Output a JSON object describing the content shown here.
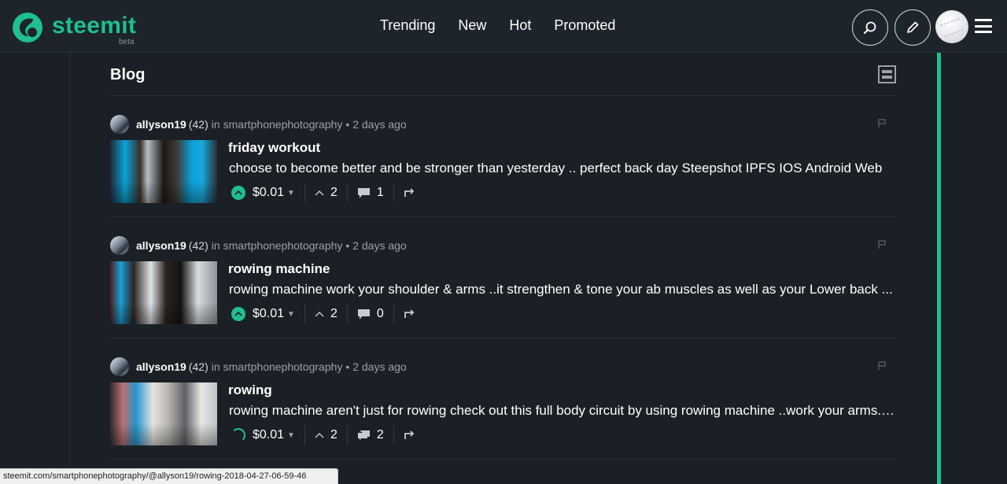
{
  "app": {
    "brand": "steemit",
    "beta": "beta",
    "brand_color": "#1fbf8f"
  },
  "nav": {
    "items": [
      {
        "label": "Trending"
      },
      {
        "label": "New"
      },
      {
        "label": "Hot"
      },
      {
        "label": "Promoted"
      }
    ]
  },
  "header": {
    "search_icon": "search-icon",
    "edit_icon": "pencil-icon",
    "menu_icon": "hamburger-icon"
  },
  "blog": {
    "title": "Blog"
  },
  "posts": [
    {
      "author": "allyson19",
      "reputation": "(42)",
      "in_label": "in",
      "community": "smartphonephotography",
      "time": "• 2 days ago",
      "title": "friday workout",
      "excerpt": "choose to become better and be stronger than yesterday .. perfect back day Steepshot IPFS IOS Android Web",
      "payout": "$0.01",
      "votes": "2",
      "comments": "1"
    },
    {
      "author": "allyson19",
      "reputation": "(42)",
      "in_label": "in",
      "community": "smartphonephotography",
      "time": "• 2 days ago",
      "title": "rowing machine",
      "excerpt": "rowing machine work your shoulder & arms ..it strengthen & tone your ab muscles as well as your Lower back ...",
      "payout": "$0.01",
      "votes": "2",
      "comments": "0"
    },
    {
      "author": "allyson19",
      "reputation": "(42)",
      "in_label": "in",
      "community": "smartphonephotography",
      "time": "• 2 days ago",
      "title": "rowing",
      "excerpt": "rowing machine aren't just for rowing check out this full body circuit by using rowing machine ..work your arms..l...",
      "payout": "$0.01",
      "votes": "2",
      "comments": "2"
    }
  ],
  "status_bar": {
    "url": "steemit.com/smartphonephotography/@allyson19/rowing-2018-04-27-06-59-46"
  }
}
